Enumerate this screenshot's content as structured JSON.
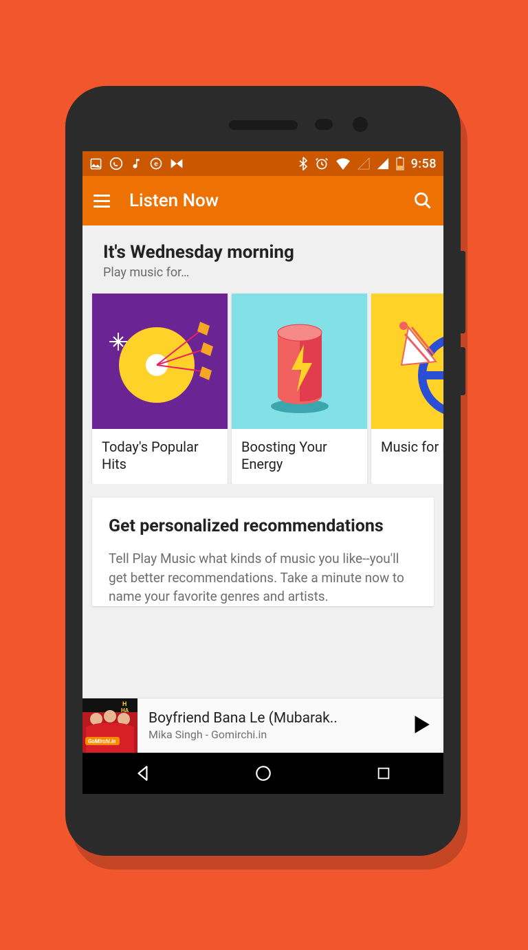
{
  "status": {
    "time": "9:58"
  },
  "app_bar": {
    "title": "Listen Now"
  },
  "section": {
    "title": "It's Wednesday morning",
    "subtitle": "Play music for…"
  },
  "cards": [
    {
      "label": "Today's Popular Hits",
      "bg": "#6b2494"
    },
    {
      "label": "Boosting Your Energy",
      "bg": "#82e0e6"
    },
    {
      "label": "Music for Driving",
      "bg": "#ffd22a"
    }
  ],
  "reco": {
    "title": "Get personalized recommendations",
    "body": "Tell Play Music what kinds of music you like--you'll get better recommendations. Take a minute now to name your favorite genres and artists."
  },
  "now_playing": {
    "title": "Boyfriend Bana Le (Mubarak..",
    "artist": "Mika Singh - Gomirchi.in",
    "art_tag": "GoMirchi.in"
  }
}
